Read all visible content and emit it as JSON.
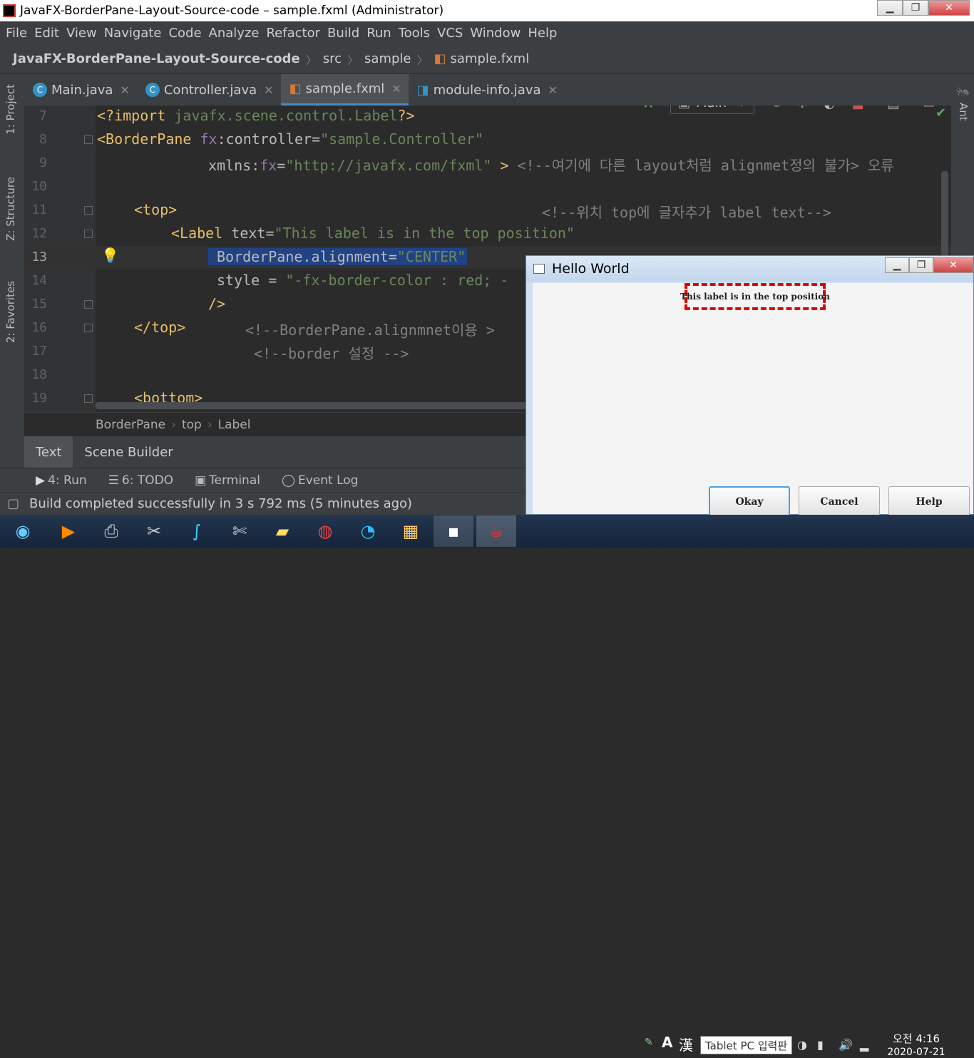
{
  "window": {
    "title": "JavaFX-BorderPane-Layout-Source-code – sample.fxml (Administrator)"
  },
  "menu": [
    "File",
    "Edit",
    "View",
    "Navigate",
    "Code",
    "Analyze",
    "Refactor",
    "Build",
    "Run",
    "Tools",
    "VCS",
    "Window",
    "Help"
  ],
  "nav": {
    "project": "JavaFX-BorderPane-Layout-Source-code",
    "src": "src",
    "pkg": "sample",
    "file": "sample.fxml",
    "runconfig": "Main"
  },
  "tabs": [
    {
      "label": "Main.java"
    },
    {
      "label": "Controller.java"
    },
    {
      "label": "sample.fxml"
    },
    {
      "label": "module-info.java"
    }
  ],
  "tools": {
    "project": "1: Project",
    "structure": "Z: Structure",
    "favorites": "2: Favorites",
    "ant": "Ant"
  },
  "lines": [
    "7",
    "8",
    "9",
    "10",
    "11",
    "12",
    "13",
    "14",
    "15",
    "16",
    "17",
    "18",
    "19"
  ],
  "code": {
    "l7a": "<?import ",
    "l7b": "javafx.scene.control.Label",
    "l7c": "?>",
    "l8a": "<BorderPane ",
    "l8b": "fx",
    ":": ":",
    "l8c": "controller=",
    "l8d": "\"sample.Controller\"",
    "l9a": "xmlns:",
    "l9b": "fx",
    "l9c": "=",
    "l9d": "\"http://javafx.com/fxml\"",
    "l9e": " > ",
    "l9f": "<!--여기에 다른 layout처럼 alignmet정의 불가> 오류",
    "l11a": "<top>",
    "l11b": "<!--위치 top에 글자추가 label text-->",
    "l12a": "<Label ",
    "l12b": "text=",
    "l12c": "\"This label is in the top position\"",
    "l13a": "BorderPane.alignment=",
    "l13b": "\"CENTER\"",
    "l14a": "style = ",
    "l14b": "\"-fx-border-color : red; -",
    "l15": "/>",
    "l16a": "</top>",
    "l16b": "<!--BorderPane.alignmnet이용 > ",
    "l17": "<!--border 설정 -->",
    "l19": "<bottom>"
  },
  "breadcrumb": {
    "a": "BorderPane",
    "b": "top",
    "c": "Label"
  },
  "viewtabs": {
    "text": "Text",
    "scene": "Scene Builder"
  },
  "toolwindows": {
    "run": "4: Run",
    "todo": "6: TODO",
    "terminal": "Terminal",
    "eventlog": "Event Log"
  },
  "status": "Build completed successfully in 3 s 792 ms (5 minutes ago)",
  "fx": {
    "title": "Hello World",
    "label": "This label is in the top position",
    "ok": "Okay",
    "cancel": "Cancel",
    "help": "Help"
  },
  "taskbar": {
    "tooltip": "Tablet PC 입력판",
    "time": "오전 4:16",
    "date": "2020-07-21",
    "ime1": "A",
    "ime2": "漢"
  }
}
